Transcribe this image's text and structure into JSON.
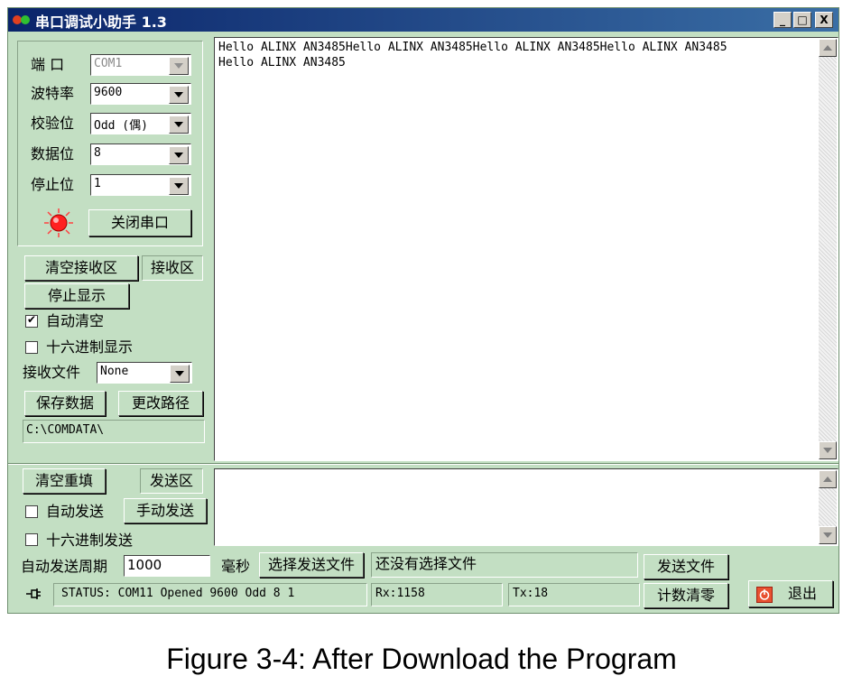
{
  "window": {
    "title": "串口调试小助手 1.3",
    "controls": {
      "minimize": "_",
      "maximize": "□",
      "close": "X"
    }
  },
  "port_settings": {
    "port_label": "端  口",
    "port_value": "COM1",
    "baud_label": "波特率",
    "baud_value": "9600",
    "parity_label": "校验位",
    "parity_value": "Odd  (偶)",
    "databits_label": "数据位",
    "databits_value": "8",
    "stopbits_label": "停止位",
    "stopbits_value": "1",
    "close_port_button": "关闭串口",
    "led_color": "#ff2020"
  },
  "receive": {
    "clear_button": "清空接收区",
    "area_label": "接收区",
    "stop_display_button": "停止显示",
    "auto_clear_label": "自动清空",
    "auto_clear_checked": true,
    "hex_display_label": "十六进制显示",
    "hex_display_checked": false,
    "file_label": "接收文件",
    "file_value": "None",
    "save_button": "保存数据",
    "change_path_button": "更改路径",
    "path": "C:\\COMDATA\\",
    "text_line1": "Hello ALINX AN3485Hello ALINX AN3485Hello ALINX AN3485Hello ALINX AN3485",
    "text_line2": "Hello ALINX AN3485"
  },
  "send": {
    "clear_button": "清空重填",
    "area_label": "发送区",
    "auto_send_label": "自动发送",
    "auto_send_checked": false,
    "manual_send_button": "手动发送",
    "hex_send_label": "十六进制发送",
    "hex_send_checked": false,
    "period_label": "自动发送周期",
    "period_value": "1000",
    "ms_label": "毫秒",
    "select_file_button": "选择发送文件",
    "file_status": "还没有选择文件",
    "send_file_button": "发送文件"
  },
  "status": {
    "status_text": "STATUS: COM11 Opened 9600 Odd   8 1",
    "rx": "Rx:1158",
    "tx": "Tx:18",
    "reset_count_button": "计数清零",
    "exit_button": "退出"
  },
  "caption": "Figure 3-4: After Download the Program"
}
